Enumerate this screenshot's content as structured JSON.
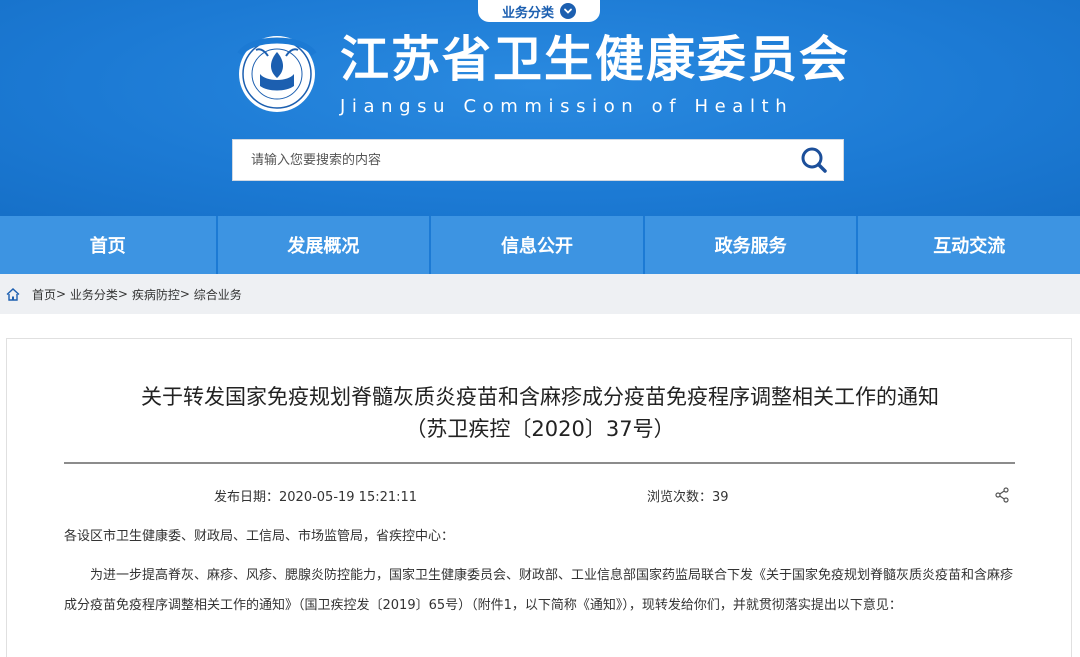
{
  "header": {
    "biz_tab_label": "业务分类",
    "site_title_cn": "江苏省卫生健康委员会",
    "site_title_en": "Jiangsu Commission of Health",
    "search_placeholder": "请输入您要搜索的内容"
  },
  "nav": {
    "items": [
      {
        "label": "首页"
      },
      {
        "label": "发展概况"
      },
      {
        "label": "信息公开"
      },
      {
        "label": "政务服务"
      },
      {
        "label": "互动交流"
      }
    ]
  },
  "breadcrumb": {
    "items": [
      "首页",
      "业务分类",
      "疾病防控",
      "综合业务"
    ],
    "separator": ">"
  },
  "article": {
    "title_line1": "关于转发国家免疫规划脊髓灰质炎疫苗和含麻疹成分疫苗免疫程序调整相关工作的通知",
    "title_line2": "（苏卫疾控〔2020〕37号）",
    "publish_date": "发布日期：2020-05-19 15:21:11",
    "views": "浏览次数：39",
    "salutation": "各设区市卫生健康委、财政局、工信局、市场监管局，省疾控中心：",
    "paragraph": "为进一步提高脊灰、麻疹、风疹、腮腺炎防控能力，国家卫生健康委员会、财政部、工业信息部国家药监局联合下发《关于国家免疫规划脊髓灰质炎疫苗和含麻疹成分疫苗免疫程序调整相关工作的通知》（国卫疾控发〔2019〕65号）（附件1，以下简称《通知》），现转发给你们，并就贯彻落实提出以下意见："
  },
  "colors": {
    "header_blue": "#1c7ad4",
    "nav_item_blue": "#3d94e2",
    "biz_tab_text": "#1c5fb0",
    "breadcrumb_bg": "#eef0f3"
  },
  "icons": {
    "biz_tab": "chevron-down-circle-icon",
    "logo": "commission-emblem-logo",
    "search": "search-icon",
    "home": "home-icon",
    "share": "share-icon"
  }
}
